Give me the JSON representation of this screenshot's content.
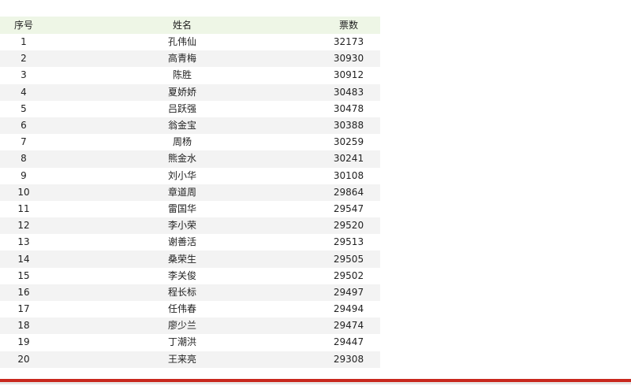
{
  "table": {
    "headers": {
      "rank": "序号",
      "name": "姓名",
      "votes": "票数"
    },
    "rows": [
      {
        "rank": "1",
        "name": "孔伟仙",
        "votes": "32173"
      },
      {
        "rank": "2",
        "name": "高青梅",
        "votes": "30930"
      },
      {
        "rank": "3",
        "name": "陈胜",
        "votes": "30912"
      },
      {
        "rank": "4",
        "name": "夏娇娇",
        "votes": "30483"
      },
      {
        "rank": "5",
        "name": "吕跃强",
        "votes": "30478"
      },
      {
        "rank": "6",
        "name": "翁金宝",
        "votes": "30388"
      },
      {
        "rank": "7",
        "name": "周杨",
        "votes": "30259"
      },
      {
        "rank": "8",
        "name": "熊金水",
        "votes": "30241"
      },
      {
        "rank": "9",
        "name": "刘小华",
        "votes": "30108"
      },
      {
        "rank": "10",
        "name": "章道周",
        "votes": "29864"
      },
      {
        "rank": "11",
        "name": "雷国华",
        "votes": "29547"
      },
      {
        "rank": "12",
        "name": "李小荣",
        "votes": "29520"
      },
      {
        "rank": "13",
        "name": "谢善活",
        "votes": "29513"
      },
      {
        "rank": "14",
        "name": "桑荣生",
        "votes": "29505"
      },
      {
        "rank": "15",
        "name": "李关俊",
        "votes": "29502"
      },
      {
        "rank": "16",
        "name": "程长标",
        "votes": "29497"
      },
      {
        "rank": "17",
        "name": "任伟春",
        "votes": "29494"
      },
      {
        "rank": "18",
        "name": "廖少兰",
        "votes": "29474"
      },
      {
        "rank": "19",
        "name": "丁潮洪",
        "votes": "29447"
      },
      {
        "rank": "20",
        "name": "王来亮",
        "votes": "29308"
      }
    ]
  },
  "colors": {
    "header_bg": "#eef6e6",
    "stripe_bg": "#f3f3f3",
    "accent_rule": "#c8281e"
  }
}
